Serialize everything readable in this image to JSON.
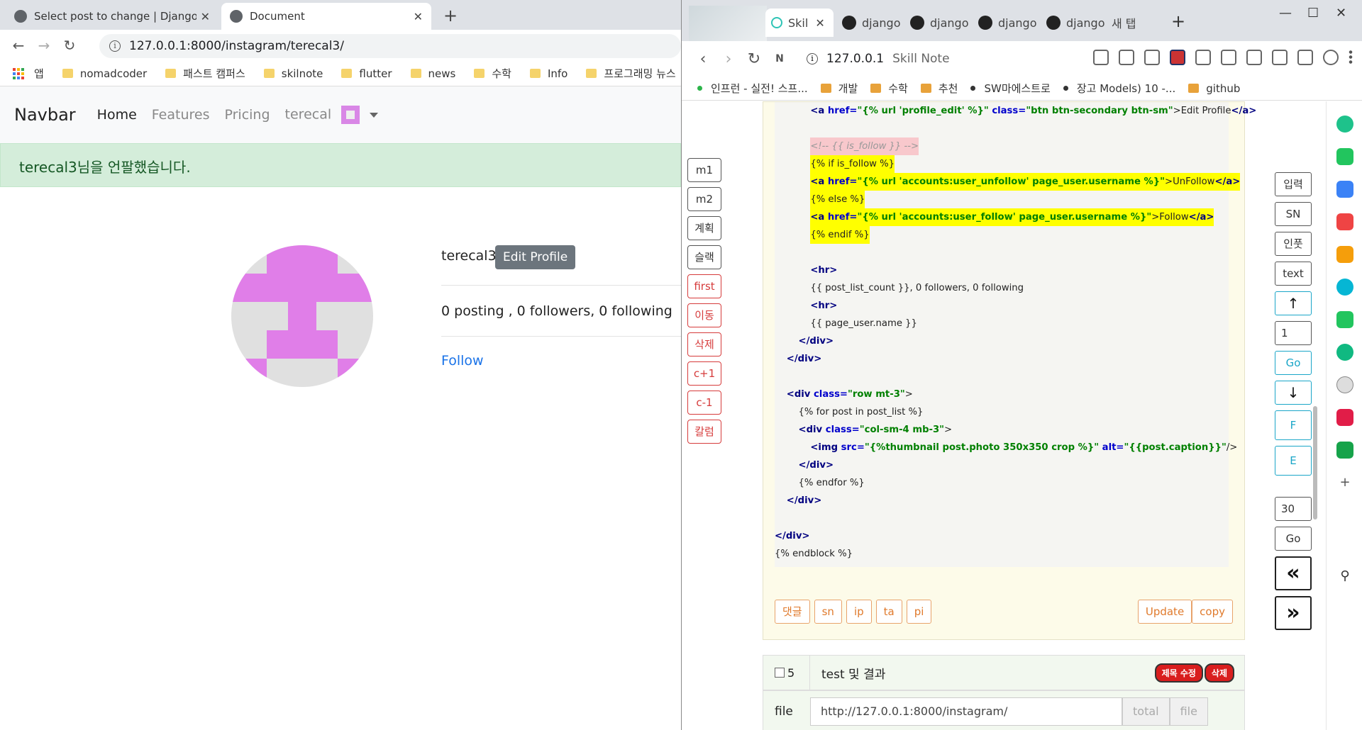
{
  "left_browser": {
    "tabs": [
      {
        "title": "Select post to change | Django",
        "active": false
      },
      {
        "title": "Document",
        "active": true
      }
    ],
    "url": "127.0.0.1:8000/instagram/terecal3/",
    "bookmarks": [
      "앱",
      "nomadcoder",
      "패스트 캠퍼스",
      "skilnote",
      "flutter",
      "news",
      "수학",
      "Info",
      "프로그래밍 뉴스"
    ],
    "navbar": {
      "brand": "Navbar",
      "links": [
        "Home",
        "Features",
        "Pricing",
        "terecal"
      ]
    },
    "alert": "terecal3님을 언팔했습니다.",
    "profile": {
      "username": "terecal3",
      "edit_button": "Edit Profile",
      "counts": "0 posting , 0 followers, 0 following",
      "follow_link": "Follow"
    },
    "colors": {
      "alert_bg": "#d4edda",
      "avatar_pink": "#e07ee8",
      "link_blue": "#1a73e8"
    }
  },
  "right_browser": {
    "tabs": [
      {
        "title": "Skil",
        "active": true
      },
      {
        "title": "django",
        "active": false
      },
      {
        "title": "django",
        "active": false
      },
      {
        "title": "django",
        "active": false
      },
      {
        "title": "django",
        "active": false
      },
      {
        "title": "새 탭",
        "active": false
      }
    ],
    "url": "127.0.0.1",
    "url_title": "Skill Note",
    "bookmarks": [
      "인프런 - 실전! 스프...",
      "개발",
      "수학",
      "추천",
      "SW마에스트로",
      "장고 Models) 10 -...",
      "github"
    ],
    "left_buttons": [
      "m1",
      "m2",
      "계획",
      "슬랙",
      "first",
      "이동",
      "삭제",
      "c+1",
      "c-1",
      "칼럼"
    ],
    "code_lines": [
      {
        "pre": "            ",
        "parts": [
          {
            "t": "<a ",
            "c": "tag"
          },
          {
            "t": "href=",
            "c": "attr"
          },
          {
            "t": "\"{% url 'profile_edit' %}\"",
            "c": "str"
          },
          {
            "t": " class=",
            "c": "attr"
          },
          {
            "t": "\"btn btn-secondary btn-sm\"",
            "c": "str"
          },
          {
            "t": ">Edit Profile",
            "c": ""
          },
          {
            "t": "</a>",
            "c": "tag"
          }
        ],
        "hl": ""
      },
      {
        "pre": "",
        "parts": [],
        "hl": ""
      },
      {
        "pre": "            ",
        "parts": [
          {
            "t": "<!-- {{ is_follow }} -->",
            "c": ""
          }
        ],
        "hl": "p"
      },
      {
        "pre": "            ",
        "parts": [
          {
            "t": "{% if is_follow %}",
            "c": ""
          }
        ],
        "hl": "y"
      },
      {
        "pre": "            ",
        "parts": [
          {
            "t": "<a ",
            "c": "tag"
          },
          {
            "t": "href=",
            "c": "attr"
          },
          {
            "t": "\"{% url 'accounts:user_unfollow' page_user.username %}\"",
            "c": "str"
          },
          {
            "t": ">UnFollow",
            "c": ""
          },
          {
            "t": "</a>",
            "c": "tag"
          }
        ],
        "hl": "y"
      },
      {
        "pre": "            ",
        "parts": [
          {
            "t": "{% else %}",
            "c": ""
          }
        ],
        "hl": "y"
      },
      {
        "pre": "            ",
        "parts": [
          {
            "t": "<a ",
            "c": "tag"
          },
          {
            "t": "href=",
            "c": "attr"
          },
          {
            "t": "\"{% url 'accounts:user_follow' page_user.username %}\"",
            "c": "str"
          },
          {
            "t": ">Follow",
            "c": ""
          },
          {
            "t": "</a>",
            "c": "tag"
          }
        ],
        "hl": "y"
      },
      {
        "pre": "            ",
        "parts": [
          {
            "t": "{% endif %}",
            "c": ""
          }
        ],
        "hl": "y"
      },
      {
        "pre": "",
        "parts": [],
        "hl": ""
      },
      {
        "pre": "            ",
        "parts": [
          {
            "t": "<hr>",
            "c": "tag"
          }
        ],
        "hl": ""
      },
      {
        "pre": "            ",
        "parts": [
          {
            "t": "{{ post_list_count }}, 0 followers, 0 following",
            "c": ""
          }
        ],
        "hl": ""
      },
      {
        "pre": "            ",
        "parts": [
          {
            "t": "<hr>",
            "c": "tag"
          }
        ],
        "hl": ""
      },
      {
        "pre": "            ",
        "parts": [
          {
            "t": "{{ page_user.name }}",
            "c": ""
          }
        ],
        "hl": ""
      },
      {
        "pre": "        ",
        "parts": [
          {
            "t": "</div>",
            "c": "tag"
          }
        ],
        "hl": ""
      },
      {
        "pre": "    ",
        "parts": [
          {
            "t": "</div>",
            "c": "tag"
          }
        ],
        "hl": ""
      },
      {
        "pre": "",
        "parts": [],
        "hl": ""
      },
      {
        "pre": "    ",
        "parts": [
          {
            "t": "<div ",
            "c": "tag"
          },
          {
            "t": "class=",
            "c": "attr"
          },
          {
            "t": "\"row mt-3\"",
            "c": "str"
          },
          {
            "t": ">",
            "c": ""
          }
        ],
        "hl": ""
      },
      {
        "pre": "        ",
        "parts": [
          {
            "t": "{% for post in post_list %}",
            "c": ""
          }
        ],
        "hl": ""
      },
      {
        "pre": "        ",
        "parts": [
          {
            "t": "<div ",
            "c": "tag"
          },
          {
            "t": "class=",
            "c": "attr"
          },
          {
            "t": "\"col-sm-4 mb-3\"",
            "c": "str"
          },
          {
            "t": ">",
            "c": ""
          }
        ],
        "hl": ""
      },
      {
        "pre": "            ",
        "parts": [
          {
            "t": "<img ",
            "c": "tag"
          },
          {
            "t": "src=",
            "c": "attr"
          },
          {
            "t": "\"{%thumbnail post.photo 350x350 crop %}\"",
            "c": "str"
          },
          {
            "t": " alt=",
            "c": "attr"
          },
          {
            "t": "\"{{post.caption}}\"",
            "c": "str"
          },
          {
            "t": "/>",
            "c": ""
          }
        ],
        "hl": ""
      },
      {
        "pre": "        ",
        "parts": [
          {
            "t": "</div>",
            "c": "tag"
          }
        ],
        "hl": ""
      },
      {
        "pre": "        ",
        "parts": [
          {
            "t": "{% endfor %}",
            "c": ""
          }
        ],
        "hl": ""
      },
      {
        "pre": "    ",
        "parts": [
          {
            "t": "</div>",
            "c": "tag"
          }
        ],
        "hl": ""
      },
      {
        "pre": "",
        "parts": [],
        "hl": ""
      },
      {
        "pre": "",
        "parts": [
          {
            "t": "</div>",
            "c": "tag"
          }
        ],
        "hl": ""
      },
      {
        "pre": "",
        "parts": [
          {
            "t": "{% endblock %}",
            "c": ""
          }
        ],
        "hl": ""
      }
    ],
    "card_buttons": [
      "댓글",
      "sn",
      "ip",
      "ta",
      "pi"
    ],
    "card_buttons_right": [
      "Update",
      "copy"
    ],
    "note_row": {
      "number": "5",
      "title": "test 및 결과",
      "edit_title_badge": "제목 수정",
      "delete_badge": "삭제"
    },
    "file_row": {
      "label": "file",
      "value": "http://127.0.0.1:8000/instagram/",
      "total_button": "total",
      "file_button": "file"
    },
    "right_buttons": {
      "input_btn": "입력",
      "sn_btn": "SN",
      "infra_btn": "인풋",
      "text_btn": "text",
      "page_value": "1",
      "go_btn": "Go",
      "f_btn": "F",
      "e_btn": "E",
      "count_value": "30",
      "go2_btn": "Go"
    }
  }
}
